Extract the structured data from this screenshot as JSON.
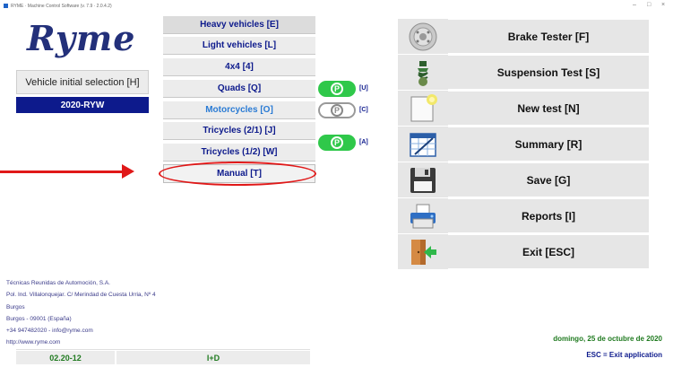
{
  "window": {
    "title": "RYME · Machine Control Software (v. 7.9 · 2.0.4.2)",
    "controls": [
      "–",
      "□",
      "×"
    ]
  },
  "logo": {
    "text": "Ryme"
  },
  "vehicle_selection": {
    "label": "Vehicle initial selection [H]",
    "plate": "2020-RYW"
  },
  "vehicle_types": [
    {
      "label": "Heavy vehicles [E]"
    },
    {
      "label": "Light vehicles [L]"
    },
    {
      "label": "4x4 [4]"
    },
    {
      "label": "Quads [Q]"
    },
    {
      "label": "Motorcycles [O]"
    },
    {
      "label": "Tricycles (2/1) [J]"
    },
    {
      "label": "Tricycles (1/2) [W]"
    },
    {
      "label": "Manual [T]"
    }
  ],
  "p_indicators": [
    {
      "icon": "p-green-icon",
      "tag": "[U]",
      "color": "#2fc84a"
    },
    {
      "icon": "p-grey-icon",
      "tag": "[C]",
      "color": "#888888"
    },
    {
      "icon": "p-green-icon",
      "tag": "[A]",
      "color": "#2fc84a"
    }
  ],
  "actions": [
    {
      "label": "Brake Tester [F]",
      "icon": "brake-disc-icon"
    },
    {
      "label": "Suspension Test [S]",
      "icon": "suspension-icon"
    },
    {
      "label": "New test [N]",
      "icon": "new-document-icon"
    },
    {
      "label": "Summary [R]",
      "icon": "summary-chart-icon"
    },
    {
      "label": "Save [G]",
      "icon": "floppy-disk-icon"
    },
    {
      "label": "Reports [I]",
      "icon": "printer-icon"
    },
    {
      "label": "Exit [ESC]",
      "icon": "exit-door-icon"
    }
  ],
  "company": {
    "lines": [
      "Técnicas Reunidas de Automoción, S.A.",
      "Pol. Ind. Villalonquejar. C/ Merindad de Cuesta Urria, Nº 4",
      "Burgos",
      "Burgos - 09001 (España)",
      "+34 947482020 - info@ryme.com",
      "http://www.ryme.com"
    ]
  },
  "footer": {
    "version": "02.20-12",
    "mode": "I+D",
    "date": "domingo, 25 de octubre de 2020",
    "esc_hint": "ESC = Exit application"
  },
  "colors": {
    "brand_blue": "#0d1a8c",
    "logo_blue": "#23307a",
    "green_text": "#1f7a1f",
    "annotation_red": "#e01818",
    "button_bg": "#ececec"
  }
}
